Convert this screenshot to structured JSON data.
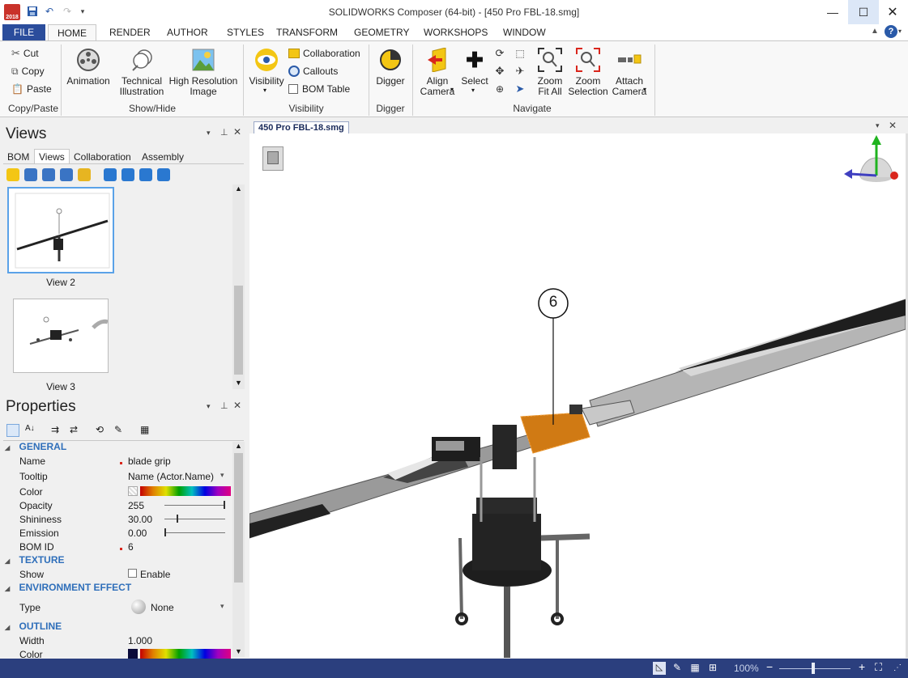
{
  "window": {
    "title": "SOLIDWORKS Composer (64-bit) - [450 Pro FBL-18.smg]",
    "year_badge": "2018"
  },
  "menu_tabs": [
    "FILE",
    "HOME",
    "RENDER",
    "AUTHOR",
    "STYLES",
    "TRANSFORM",
    "GEOMETRY",
    "WORKSHOPS",
    "WINDOW"
  ],
  "ribbon": {
    "copy_paste": {
      "cut": "Cut",
      "copy": "Copy",
      "paste": "Paste",
      "group": "Copy/Paste"
    },
    "show_hide": {
      "animation": "Animation",
      "technical": "Technical\nIllustration",
      "high_res": "High Resolution\nImage",
      "group": "Show/Hide"
    },
    "visibility": {
      "visibility": "Visibility",
      "collaboration": "Collaboration",
      "callouts": "Callouts",
      "bom_table": "BOM Table",
      "group": "Visibility"
    },
    "digger": {
      "digger": "Digger",
      "group": "Digger"
    },
    "navigate": {
      "align_camera": "Align\nCamera",
      "select": "Select",
      "zoom_fit_all": "Zoom\nFit All",
      "zoom_selection": "Zoom\nSelection",
      "attach_camera": "Attach\nCamera",
      "group": "Navigate"
    }
  },
  "views_panel": {
    "title": "Views",
    "tabs": [
      "BOM",
      "Views",
      "Collaboration",
      "Assembly"
    ],
    "active_tab": "Views",
    "thumbnails": [
      {
        "label": "View 2",
        "selected": true
      },
      {
        "label": "View 3",
        "selected": false
      }
    ]
  },
  "properties_panel": {
    "title": "Properties",
    "sections": {
      "general": "GENERAL",
      "texture": "TEXTURE",
      "environment": "ENVIRONMENT EFFECT",
      "outline": "OUTLINE"
    },
    "rows": {
      "name": {
        "label": "Name",
        "value": "blade grip"
      },
      "tooltip": {
        "label": "Tooltip",
        "value": "Name (Actor.Name)"
      },
      "color": {
        "label": "Color"
      },
      "opacity": {
        "label": "Opacity",
        "value": "255",
        "level": 1.0
      },
      "shininess": {
        "label": "Shininess",
        "value": "30.00",
        "level": 0.2
      },
      "emission": {
        "label": "Emission",
        "value": "0.00",
        "level": 0.0
      },
      "bom_id": {
        "label": "BOM ID",
        "value": "6"
      },
      "show": {
        "label": "Show",
        "value": "Enable"
      },
      "type": {
        "label": "Type",
        "value": "None"
      },
      "width": {
        "label": "Width",
        "value": "1.000"
      },
      "outline_color": {
        "label": "Color"
      }
    }
  },
  "document": {
    "tab": "450 Pro FBL-18.smg",
    "callout_number": "6"
  },
  "status": {
    "zoom": "100%"
  },
  "colors": {
    "accent": "#2b4d9c",
    "statusbar": "#2b3f7e",
    "selection": "#e07a1a",
    "section": "#2f6fba"
  }
}
